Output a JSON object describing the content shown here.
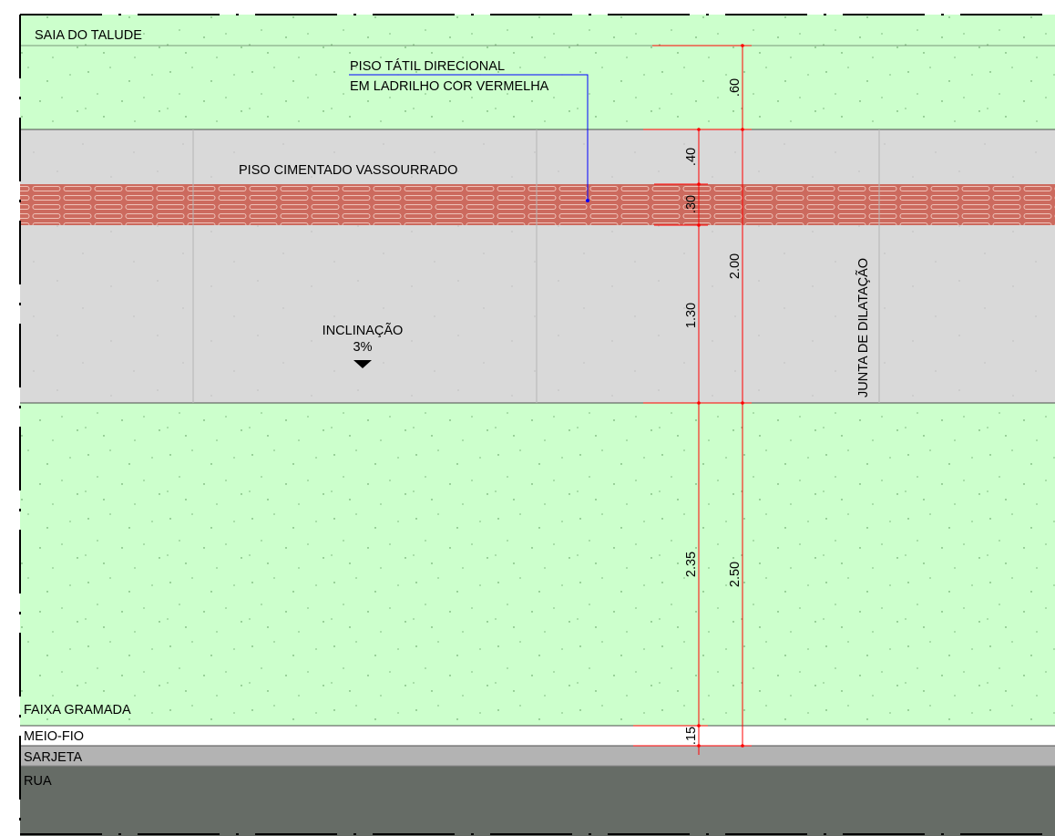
{
  "labels": {
    "saia_talude": "SAIA DO TALUDE",
    "piso_tatil_line1": "PISO TÁTIL DIRECIONAL",
    "piso_tatil_line2": "EM LADRILHO COR VERMELHA",
    "piso_cimentado": "PISO CIMENTADO VASSOURRADO",
    "inclinacao": "INCLINAÇÃO",
    "inclinacao_valor": "3%",
    "junta": "JUNTA DE DILATAÇÃO",
    "faixa_gramada": "FAIXA GRAMADA",
    "meio_fio": "MEIO-FIO",
    "sarjeta": "SARJETA",
    "rua": "RUA"
  },
  "dimensions": {
    "d_060": ".60",
    "d_040": ".40",
    "d_030": ".30",
    "d_200": "2.00",
    "d_130": "1.30",
    "d_235": "2.35",
    "d_250": "2.50",
    "d_015": ".15"
  },
  "colors": {
    "grass": "#ccffcc",
    "concrete": "#d9d9d9",
    "tactile": "#cc6a5e",
    "tactile_outline": "#e8b6ac",
    "curb": "#ffffff",
    "gutter": "#b3b3b3",
    "street": "#666c66",
    "dimension_line": "#ff0000",
    "leader_line": "#0000ff",
    "boundary": "#000000"
  }
}
